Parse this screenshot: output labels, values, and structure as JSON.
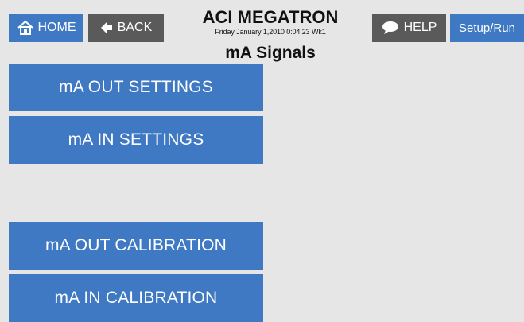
{
  "toolbar": {
    "home_label": "HOME",
    "back_label": "BACK",
    "help_label": "HELP",
    "setup_run_label": "Setup/Run"
  },
  "header": {
    "app_title": "ACI MEGATRON",
    "datetime": "Friday January 1,2010 0:04:23 Wk1",
    "page_title": "mA Signals"
  },
  "menu": {
    "items": [
      {
        "label": "mA OUT SETTINGS"
      },
      {
        "label": "mA IN SETTINGS"
      },
      {
        "label": "mA OUT CALIBRATION"
      },
      {
        "label": "mA IN CALIBRATION"
      }
    ]
  },
  "icons": {
    "home": "home-icon",
    "back": "arrow-left-icon",
    "help": "speech-bubble-icon"
  },
  "colors": {
    "background": "#e6e6e6",
    "button_blue": "#3f79c4",
    "button_dark": "#5a5a5a",
    "button_text": "#ffffff"
  }
}
